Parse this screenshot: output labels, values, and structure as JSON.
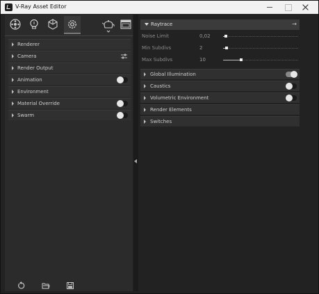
{
  "window": {
    "title": "V-Ray Asset Editor"
  },
  "toolbar": {
    "icons": [
      "materials-icon",
      "lights-icon",
      "geometry-icon",
      "settings-icon",
      "render-teapot-icon",
      "frame-buffer-icon"
    ],
    "active": "settings-icon"
  },
  "left_panel": {
    "items": [
      {
        "label": "Renderer",
        "control": "none"
      },
      {
        "label": "Camera",
        "control": "settings"
      },
      {
        "label": "Render Output",
        "control": "none"
      },
      {
        "label": "Animation",
        "control": "toggle",
        "on": false
      },
      {
        "label": "Environment",
        "control": "none"
      },
      {
        "label": "Material Override",
        "control": "toggle",
        "on": false
      },
      {
        "label": "Swarm",
        "control": "toggle",
        "on": false
      }
    ]
  },
  "bottom_bar": {
    "icons": [
      "reset-icon",
      "open-folder-icon",
      "save-icon"
    ]
  },
  "right_panel": {
    "header": {
      "label": "Raytrace"
    },
    "params": [
      {
        "label": "Noise Limit",
        "value": "0,02",
        "level": 0.02
      },
      {
        "label": "Min Subdivs",
        "value": "2",
        "level": 0.03
      },
      {
        "label": "Max Subdivs",
        "value": "10",
        "level": 0.22
      }
    ],
    "sections": [
      {
        "label": "Global Illumination",
        "control": "toggle",
        "on": true
      },
      {
        "label": "Caustics",
        "control": "toggle",
        "on": false
      },
      {
        "label": "Volumetric Environment",
        "control": "toggle",
        "on": false
      },
      {
        "label": "Render Elements",
        "control": "none"
      },
      {
        "label": "Switches",
        "control": "none"
      }
    ]
  }
}
